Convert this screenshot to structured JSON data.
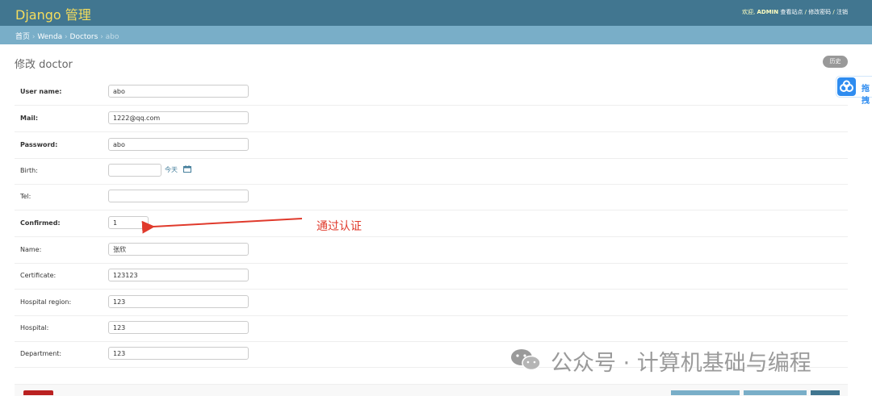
{
  "header": {
    "brand": "Django 管理",
    "welcome": "欢迎,",
    "user": "ADMIN",
    "view_site": "查看站点",
    "sep1": " / ",
    "change_password": "修改密码",
    "sep2": " / ",
    "logout": "注销"
  },
  "breadcrumb": {
    "home": "首页",
    "app": "Wenda",
    "model": "Doctors",
    "current": "abo",
    "sep": " › "
  },
  "page": {
    "title": "修改 doctor",
    "history_button": "历史"
  },
  "baidu_widget": {
    "label": "拖拽"
  },
  "form": {
    "username": {
      "label": "User name:",
      "value": "abo"
    },
    "mail": {
      "label": "Mail:",
      "value": "1222@qq.com"
    },
    "password": {
      "label": "Password:",
      "value": "abo"
    },
    "birth": {
      "label": "Birth:",
      "value": "",
      "today": "今天"
    },
    "tel": {
      "label": "Tel:",
      "value": ""
    },
    "confirmed": {
      "label": "Confirmed:",
      "value": "1"
    },
    "name": {
      "label": "Name:",
      "value": "张欣"
    },
    "certificate": {
      "label": "Certificate:",
      "value": "123123"
    },
    "hospital_region": {
      "label": "Hospital region:",
      "value": "123"
    },
    "hospital": {
      "label": "Hospital:",
      "value": "123"
    },
    "department": {
      "label": "Department:",
      "value": "123"
    }
  },
  "annotation": {
    "text": "通过认证",
    "color": "#e03a2c"
  },
  "watermark": {
    "text": "公众号 · 计算机基础与编程"
  },
  "colors": {
    "header": "#417690",
    "breadcrumb": "#79aec8",
    "brand": "#f5dd5d",
    "delete": "#ba2121"
  }
}
